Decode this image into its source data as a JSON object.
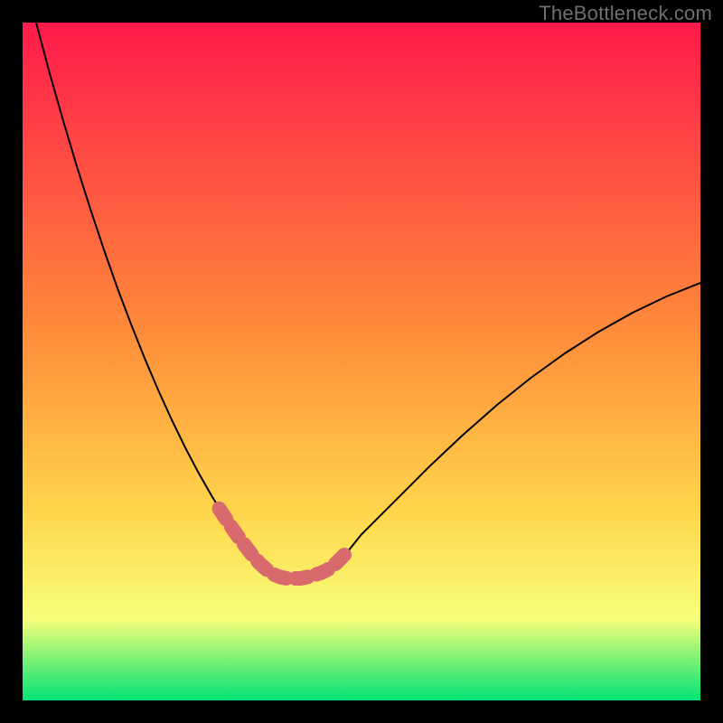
{
  "watermark": "TheBottleneck.com",
  "chart_data": {
    "type": "line",
    "title": "",
    "xlabel": "",
    "ylabel": "",
    "xlim": [
      0,
      100
    ],
    "ylim": [
      0,
      100
    ],
    "grid": false,
    "series": [
      {
        "name": "bottleneck-curve",
        "x": [
          0,
          2,
          4,
          6,
          8,
          10,
          12,
          14,
          16,
          18,
          20,
          22,
          24,
          26,
          28,
          30,
          32,
          34,
          35,
          36,
          37,
          38,
          40,
          42,
          44,
          46,
          48,
          50,
          55,
          60,
          65,
          70,
          75,
          80,
          85,
          90,
          95,
          100
        ],
        "values": [
          108,
          100,
          92.5,
          85.5,
          78.8,
          72.5,
          66.5,
          60.8,
          55.5,
          50.5,
          45.8,
          41.4,
          37.3,
          33.5,
          30,
          26.8,
          23.9,
          21.3,
          20.2,
          19.3,
          18.6,
          18.2,
          18,
          18.2,
          18.8,
          20,
          22,
          24.5,
          29.5,
          34.5,
          39.2,
          43.6,
          47.6,
          51.2,
          54.4,
          57.2,
          59.6,
          61.6
        ]
      }
    ],
    "highlight_band": {
      "name": "sweet-spot",
      "x": [
        29,
        30,
        31,
        32,
        33,
        34,
        35,
        36,
        37,
        38,
        39,
        40,
        41,
        42,
        43,
        44,
        45,
        46,
        47,
        48
      ],
      "values": [
        28.3,
        26.8,
        25.3,
        23.9,
        22.6,
        21.3,
        20.2,
        19.3,
        18.6,
        18.2,
        18.0,
        18.0,
        18.0,
        18.2,
        18.5,
        18.8,
        19.3,
        20.0,
        21.0,
        22.0
      ]
    },
    "background_gradient": {
      "top": "#ff1a4b",
      "mid": "#ffd54a",
      "bottom": "#00e374"
    }
  }
}
